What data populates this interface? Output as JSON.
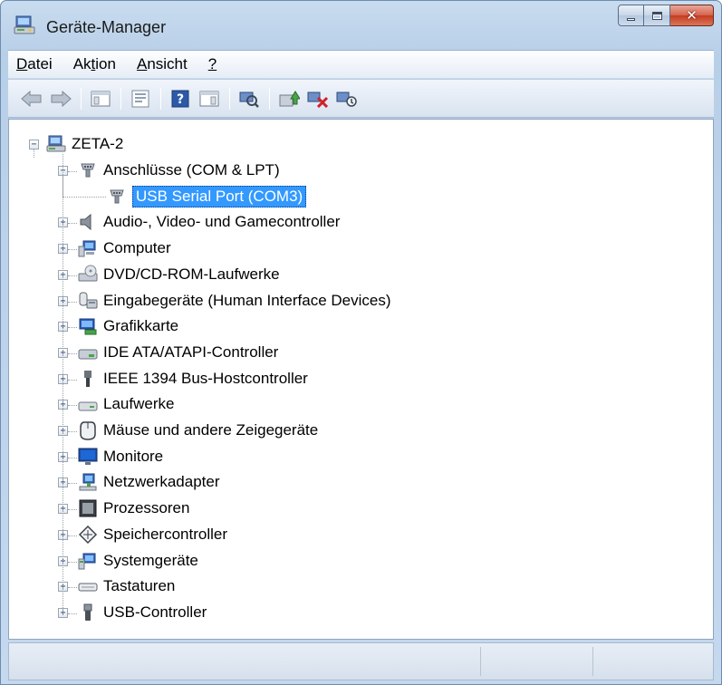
{
  "window": {
    "title": "Geräte-Manager",
    "title_icon": "device-manager-icon",
    "buttons": [
      "minimize",
      "maximize",
      "close"
    ]
  },
  "menu": {
    "items": [
      {
        "label": "Datei",
        "accel": "D"
      },
      {
        "label": "Aktion",
        "accel": "t"
      },
      {
        "label": "Ansicht",
        "accel": "A"
      },
      {
        "label": "?",
        "accel": "?"
      }
    ]
  },
  "toolbar": {
    "buttons": [
      {
        "icon": "back-arrow-icon"
      },
      {
        "icon": "forward-arrow-icon"
      },
      {
        "icon": "show-hide-console-tree-icon"
      },
      {
        "icon": "properties-icon"
      },
      {
        "icon": "help-icon"
      },
      {
        "icon": "show-action-pane-icon"
      },
      {
        "icon": "scan-hardware-icon"
      },
      {
        "icon": "update-driver-icon"
      },
      {
        "icon": "uninstall-device-icon"
      },
      {
        "icon": "disable-device-icon"
      }
    ]
  },
  "tree": {
    "root": {
      "label": "ZETA-2",
      "icon": "computer-network-icon",
      "expanded": true
    },
    "categories": [
      {
        "label": "Anschlüsse (COM & LPT)",
        "icon": "port-connector-icon",
        "expanded": true,
        "children": [
          {
            "label": "USB Serial Port (COM3)",
            "icon": "port-connector-icon",
            "selected": true
          }
        ]
      },
      {
        "label": "Audio-, Video- und Gamecontroller",
        "icon": "speaker-icon",
        "expanded": false
      },
      {
        "label": "Computer",
        "icon": "computer-icon",
        "expanded": false
      },
      {
        "label": "DVD/CD-ROM-Laufwerke",
        "icon": "dvd-drive-icon",
        "expanded": false
      },
      {
        "label": "Eingabegeräte (Human Interface Devices)",
        "icon": "hid-icon",
        "expanded": false
      },
      {
        "label": "Grafikkarte",
        "icon": "display-adapter-icon",
        "expanded": false
      },
      {
        "label": "IDE ATA/ATAPI-Controller",
        "icon": "ide-controller-icon",
        "expanded": false
      },
      {
        "label": "IEEE 1394 Bus-Hostcontroller",
        "icon": "ieee1394-icon",
        "expanded": false
      },
      {
        "label": "Laufwerke",
        "icon": "hard-drive-icon",
        "expanded": false
      },
      {
        "label": "Mäuse und andere Zeigegeräte",
        "icon": "mouse-icon",
        "expanded": false
      },
      {
        "label": "Monitore",
        "icon": "monitor-icon",
        "expanded": false
      },
      {
        "label": "Netzwerkadapter",
        "icon": "network-adapter-icon",
        "expanded": false
      },
      {
        "label": "Prozessoren",
        "icon": "processor-icon",
        "expanded": false
      },
      {
        "label": "Speichercontroller",
        "icon": "storage-controller-icon",
        "expanded": false
      },
      {
        "label": "Systemgeräte",
        "icon": "system-device-icon",
        "expanded": false
      },
      {
        "label": "Tastaturen",
        "icon": "keyboard-icon",
        "expanded": false
      },
      {
        "label": "USB-Controller",
        "icon": "usb-icon",
        "expanded": false
      }
    ]
  },
  "statusbar": {
    "panes": [
      "",
      "",
      ""
    ]
  },
  "colors": {
    "selection": "#3399ff",
    "frame": "#c4d8ee",
    "close_button": "#c53b20"
  }
}
